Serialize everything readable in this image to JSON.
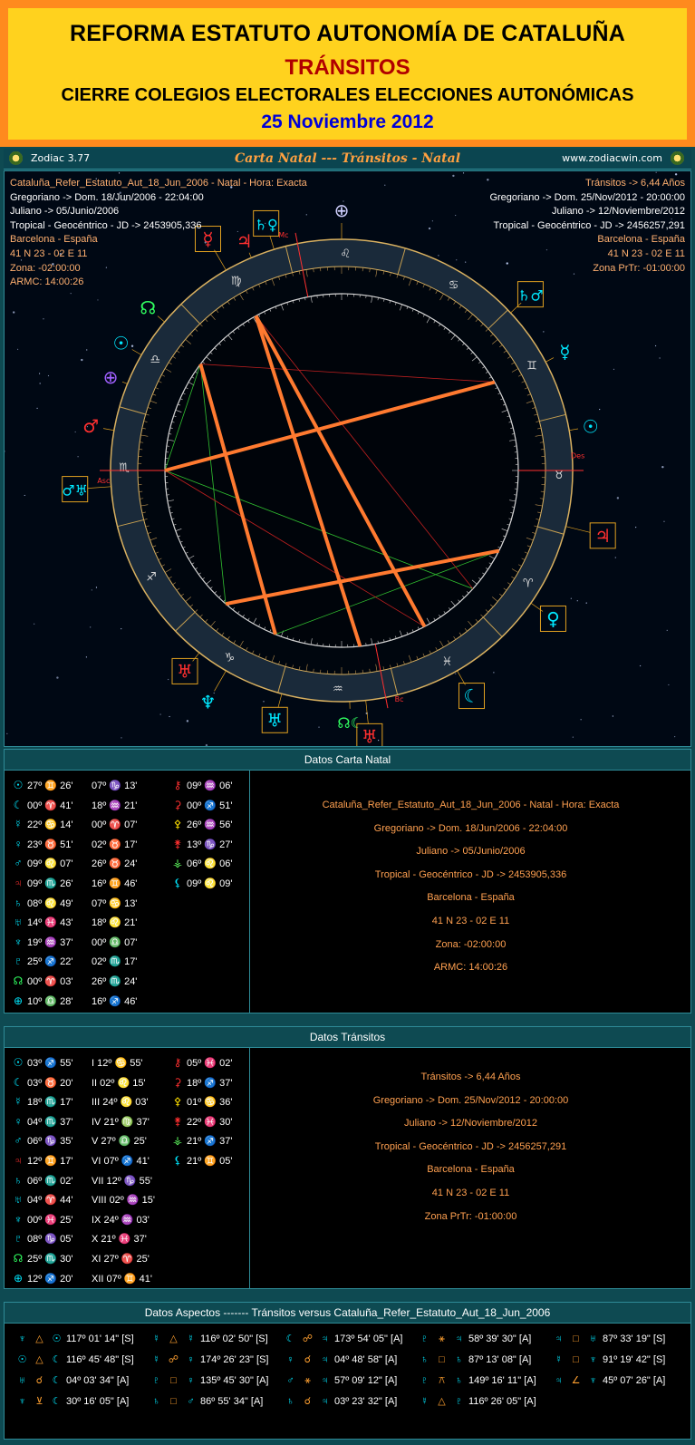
{
  "banner": {
    "line1": "REFORMA ESTATUTO AUTONOMÍA DE CATALUÑA",
    "line2": "TRÁNSITOS",
    "line3": "CIERRE COLEGIOS ELECTORALES ELECCIONES AUTONÓMICAS",
    "line4": "25 Noviembre 2012"
  },
  "window": {
    "version": "Zodiac 3.77",
    "title": "Carta Natal --- Tránsitos - Natal",
    "website": "www.zodiacwin.com"
  },
  "natal_info": [
    "Cataluña_Refer_Estatuto_Aut_18_Jun_2006 - Natal - Hora: Exacta",
    "Gregoriano -> Dom. 18/Jun/2006 - 22:04:00",
    "Juliano -> 05/Junio/2006",
    "Tropical - Geocéntrico - JD -> 2453905,336",
    "Barcelona - España",
    "41 N 23 - 02 E 11",
    "Zona: -02:00:00",
    "ARMC: 14:00:26"
  ],
  "transit_info": [
    "Tránsitos -> 6,44 Años",
    "Gregoriano -> Dom. 25/Nov/2012 - 20:00:00",
    "Juliano -> 12/Noviembre/2012",
    "Tropical - Geocéntrico - JD -> 2456257,291",
    "Barcelona - España",
    "41 N 23 - 02 E 11",
    "Zona PrTr: -01:00:00"
  ],
  "wheel_labels": {
    "mc": "Mc",
    "asc": "Asc",
    "des": "Des",
    "bc": "Bc"
  },
  "zodiac_signs": [
    "♈",
    "♉",
    "♊",
    "♋",
    "♌",
    "♍",
    "♎",
    "♏",
    "♐",
    "♑",
    "♒",
    "♓"
  ],
  "natal_section": {
    "header": "Datos Carta Natal",
    "planets": [
      {
        "g": "☉",
        "d": "27º",
        "s": "♊",
        "m": "26'"
      },
      {
        "g": "☾",
        "d": "00º",
        "s": "♈",
        "m": "41'"
      },
      {
        "g": "☿",
        "d": "22º",
        "s": "♋",
        "m": "14'"
      },
      {
        "g": "♀",
        "d": "23º",
        "s": "♉",
        "m": "51'"
      },
      {
        "g": "♂",
        "d": "09º",
        "s": "♌",
        "m": "07'"
      },
      {
        "g": "♃",
        "d": "09º",
        "s": "♏",
        "m": "26'"
      },
      {
        "g": "♄",
        "d": "08º",
        "s": "♌",
        "m": "49'"
      },
      {
        "g": "♅",
        "d": "14º",
        "s": "♓",
        "m": "43'"
      },
      {
        "g": "♆",
        "d": "19º",
        "s": "♒",
        "m": "37'"
      },
      {
        "g": "♇",
        "d": "25º",
        "s": "♐",
        "m": "22'"
      },
      {
        "g": "☊",
        "d": "00º",
        "s": "♈",
        "m": "03'"
      },
      {
        "g": "⊕",
        "d": "10º",
        "s": "♎",
        "m": "28'"
      }
    ],
    "houses": [
      {
        "d": "07º",
        "s": "♑",
        "m": "13'"
      },
      {
        "d": "18º",
        "s": "♒",
        "m": "21'"
      },
      {
        "d": "00º",
        "s": "♈",
        "m": "07'"
      },
      {
        "d": "02º",
        "s": "♉",
        "m": "17'"
      },
      {
        "d": "26º",
        "s": "♉",
        "m": "24'"
      },
      {
        "d": "16º",
        "s": "♊",
        "m": "46'"
      },
      {
        "d": "07º",
        "s": "♋",
        "m": "13'"
      },
      {
        "d": "18º",
        "s": "♌",
        "m": "21'"
      },
      {
        "d": "00º",
        "s": "♎",
        "m": "07'"
      },
      {
        "d": "02º",
        "s": "♏",
        "m": "17'"
      },
      {
        "d": "26º",
        "s": "♏",
        "m": "24'"
      },
      {
        "d": "16º",
        "s": "♐",
        "m": "46'"
      }
    ],
    "asteroids": [
      {
        "g": "⚷",
        "d": "09º",
        "s": "♒",
        "m": "06'"
      },
      {
        "g": "⚳",
        "d": "00º",
        "s": "♐",
        "m": "51'"
      },
      {
        "g": "⚴",
        "d": "26º",
        "s": "♒",
        "m": "56'"
      },
      {
        "g": "⚵",
        "d": "13º",
        "s": "♑",
        "m": "27'"
      },
      {
        "g": "⚶",
        "d": "06º",
        "s": "♌",
        "m": "06'"
      },
      {
        "g": "⚸",
        "d": "09º",
        "s": "♌",
        "m": "09'"
      }
    ],
    "details": [
      "Cataluña_Refer_Estatuto_Aut_18_Jun_2006 - Natal - Hora: Exacta",
      "Gregoriano -> Dom. 18/Jun/2006 - 22:04:00",
      "Juliano -> 05/Junio/2006",
      "Tropical - Geocéntrico - JD -> 2453905,336",
      "Barcelona - España",
      "41 N 23 - 02 E 11",
      "Zona: -02:00:00",
      "ARMC: 14:00:26"
    ]
  },
  "transit_section": {
    "header": "Datos Tránsitos",
    "planets": [
      {
        "g": "☉",
        "d": "03º",
        "s": "♐",
        "m": "55'"
      },
      {
        "g": "☾",
        "d": "03º",
        "s": "♉",
        "m": "20'"
      },
      {
        "g": "☿",
        "d": "18º",
        "s": "♏",
        "m": "17'"
      },
      {
        "g": "♀",
        "d": "04º",
        "s": "♏",
        "m": "37'"
      },
      {
        "g": "♂",
        "d": "06º",
        "s": "♑",
        "m": "35'"
      },
      {
        "g": "♃",
        "d": "12º",
        "s": "♊",
        "m": "17'"
      },
      {
        "g": "♄",
        "d": "06º",
        "s": "♏",
        "m": "02'"
      },
      {
        "g": "♅",
        "d": "04º",
        "s": "♈",
        "m": "44'"
      },
      {
        "g": "♆",
        "d": "00º",
        "s": "♓",
        "m": "25'"
      },
      {
        "g": "♇",
        "d": "08º",
        "s": "♑",
        "m": "05'"
      },
      {
        "g": "☊",
        "d": "25º",
        "s": "♏",
        "m": "30'"
      },
      {
        "g": "⊕",
        "d": "12º",
        "s": "♐",
        "m": "20'"
      }
    ],
    "houses": [
      {
        "h": "I",
        "d": "12º",
        "s": "♋",
        "m": "55'"
      },
      {
        "h": "II",
        "d": "02º",
        "s": "♌",
        "m": "15'"
      },
      {
        "h": "III",
        "d": "24º",
        "s": "♌",
        "m": "03'"
      },
      {
        "h": "IV",
        "d": "21º",
        "s": "♍",
        "m": "37'"
      },
      {
        "h": "V",
        "d": "27º",
        "s": "♎",
        "m": "25'"
      },
      {
        "h": "VI",
        "d": "07º",
        "s": "♐",
        "m": "41'"
      },
      {
        "h": "VII",
        "d": "12º",
        "s": "♑",
        "m": "55'"
      },
      {
        "h": "VIII",
        "d": "02º",
        "s": "♒",
        "m": "15'"
      },
      {
        "h": "IX",
        "d": "24º",
        "s": "♒",
        "m": "03'"
      },
      {
        "h": "X",
        "d": "21º",
        "s": "♓",
        "m": "37'"
      },
      {
        "h": "XI",
        "d": "27º",
        "s": "♈",
        "m": "25'"
      },
      {
        "h": "XII",
        "d": "07º",
        "s": "♊",
        "m": "41'"
      }
    ],
    "asteroids": [
      {
        "g": "⚷",
        "d": "05º",
        "s": "♓",
        "m": "02'"
      },
      {
        "g": "⚳",
        "d": "18º",
        "s": "♐",
        "m": "37'"
      },
      {
        "g": "⚴",
        "d": "01º",
        "s": "♋",
        "m": "36'"
      },
      {
        "g": "⚵",
        "d": "22º",
        "s": "♓",
        "m": "30'"
      },
      {
        "g": "⚶",
        "d": "21º",
        "s": "♐",
        "m": "37'"
      },
      {
        "g": "⚸",
        "d": "21º",
        "s": "♊",
        "m": "05'"
      }
    ],
    "details": [
      "Tránsitos -> 6,44 Años",
      "Gregoriano -> Dom. 25/Nov/2012 - 20:00:00",
      "Juliano -> 12/Noviembre/2012",
      "Tropical - Geocéntrico - JD -> 2456257,291",
      "Barcelona - España",
      "41 N 23 - 02 E 11",
      "Zona PrTr: -01:00:00"
    ]
  },
  "aspects_section": {
    "header": "Datos Aspectos    -------    Tránsitos    versus    Cataluña_Refer_Estatuto_Aut_18_Jun_2006",
    "rows": [
      [
        {
          "a": "♆",
          "x": "△",
          "b": "☉",
          "v": "117º 01' 14\" [S]"
        },
        {
          "a": "☿",
          "x": "△",
          "b": "☿",
          "v": "116º 02' 50\" [S]"
        },
        {
          "a": "☾",
          "x": "☍",
          "b": "♃",
          "v": "173º 54' 05\" [A]"
        },
        {
          "a": "♇",
          "x": "⚹",
          "b": "♃",
          "v": "58º 39' 30\" [A]"
        },
        {
          "a": "♃",
          "x": "□",
          "b": "♅",
          "v": "87º 33' 19\" [S]"
        }
      ],
      [
        {
          "a": "☉",
          "x": "△",
          "b": "☾",
          "v": "116º 45' 48\" [S]"
        },
        {
          "a": "☿",
          "x": "☍",
          "b": "♀",
          "v": "174º 26' 23\" [S]"
        },
        {
          "a": "♀",
          "x": "☌",
          "b": "♃",
          "v": "04º 48' 58\" [A]"
        },
        {
          "a": "♄",
          "x": "□",
          "b": "♄",
          "v": "87º 13' 08\" [A]"
        },
        {
          "a": "☿",
          "x": "□",
          "b": "♆",
          "v": "91º 19' 42\" [S]"
        }
      ],
      [
        {
          "a": "♅",
          "x": "☌",
          "b": "☾",
          "v": "04º 03' 34\" [A]"
        },
        {
          "a": "♇",
          "x": "□",
          "b": "♀",
          "v": "135º 45' 30\" [A]"
        },
        {
          "a": "♂",
          "x": "⚹",
          "b": "♃",
          "v": "57º 09' 12\" [A]"
        },
        {
          "a": "♇",
          "x": "⚻",
          "b": "♄",
          "v": "149º 16' 11\" [A]"
        },
        {
          "a": "♃",
          "x": "∠",
          "b": "♆",
          "v": "45º 07' 26\" [A]"
        }
      ],
      [
        {
          "a": "♆",
          "x": "⊻",
          "b": "☾",
          "v": "30º 16' 05\" [A]"
        },
        {
          "a": "♄",
          "x": "□",
          "b": "♂",
          "v": "86º 55' 34\" [A]"
        },
        {
          "a": "♄",
          "x": "☌",
          "b": "♃",
          "v": "03º 23' 32\" [A]"
        },
        {
          "a": "☿",
          "x": "△",
          "b": "♇",
          "v": "116º 26' 05\" [A]"
        }
      ]
    ]
  },
  "colors": {
    "banner_bg": "#ffd21e",
    "frame": "#ff8a1e",
    "panel": "#0e4a52",
    "natal_line": "#ff7a30",
    "info_text": "#ffa050"
  }
}
